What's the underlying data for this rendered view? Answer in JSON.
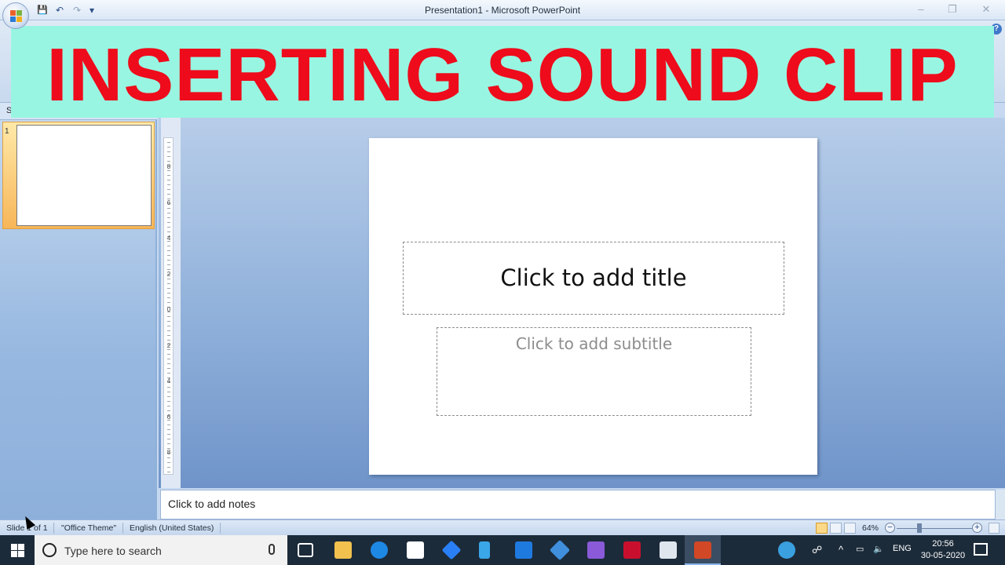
{
  "window": {
    "title": "Presentation1 - Microsoft PowerPoint",
    "minimize": "–",
    "restore": "❐",
    "close": "✕"
  },
  "qat": {
    "save": "💾",
    "undo": "↶",
    "redo": "↷",
    "customize": "▾"
  },
  "banner": {
    "text": "INSERTING SOUND CLIP"
  },
  "left_pane": {
    "tab_label": "S",
    "slide_number": "1"
  },
  "ruler": {
    "labels": [
      "8",
      "6",
      "4",
      "2",
      "0",
      "2",
      "4",
      "6",
      "8"
    ]
  },
  "slide": {
    "title_placeholder": "Click to add title",
    "subtitle_placeholder": "Click to add subtitle"
  },
  "notes": {
    "placeholder": "Click to add notes"
  },
  "status_bar": {
    "slide_info": "Slide 1 of 1",
    "theme": "\"Office Theme\"",
    "language": "English (United States)",
    "zoom": "64%",
    "zoom_minus": "−",
    "zoom_plus": "+"
  },
  "taskbar": {
    "search_placeholder": "Type here to search",
    "tray_language": "ENG",
    "time": "20:56",
    "date": "30-05-2020"
  },
  "colors": {
    "banner_bg": "#98f5e1",
    "banner_text": "#ee0b1b",
    "taskbar": "#1c2b3a"
  }
}
